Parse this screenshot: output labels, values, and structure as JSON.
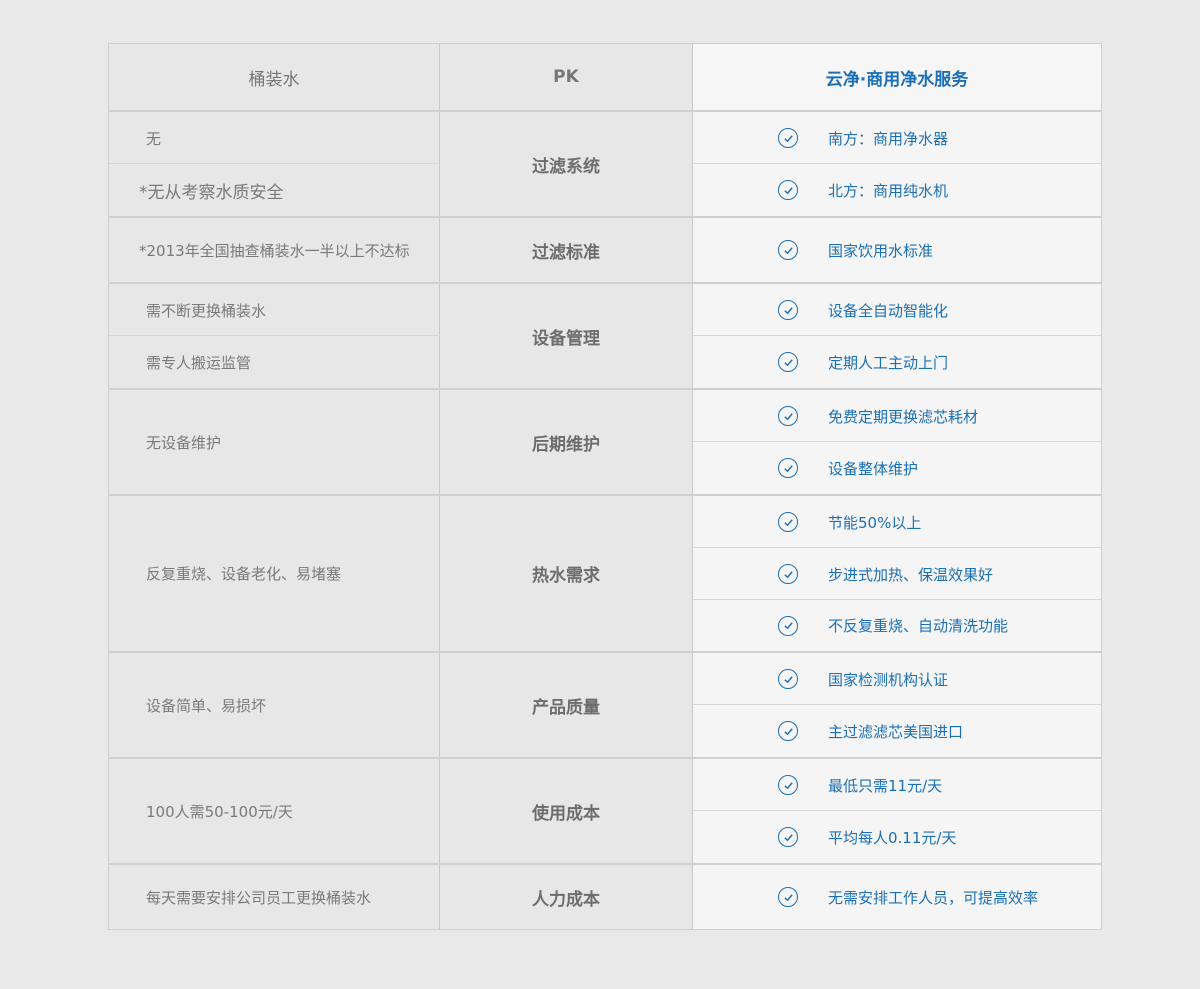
{
  "header": {
    "col_bottled": "桶装水",
    "col_pk": "PK",
    "col_service": "云净·商用净水服务"
  },
  "groups": [
    {
      "category": "过滤系统",
      "bottled": [
        "无",
        "*无从考察水质安全"
      ],
      "service": [
        "南方：商用净水器",
        "北方：商用纯水机"
      ]
    },
    {
      "category": "过滤标准",
      "bottled": [
        "*2013年全国抽查桶装水一半以上不达标"
      ],
      "service": [
        "国家饮用水标准"
      ]
    },
    {
      "category": "设备管理",
      "bottled": [
        "需不断更换桶装水",
        "需专人搬运监管"
      ],
      "service": [
        "设备全自动智能化",
        "定期人工主动上门"
      ]
    },
    {
      "category": "后期维护",
      "bottled": [
        "无设备维护"
      ],
      "service": [
        "免费定期更换滤芯耗材",
        "设备整体维护"
      ]
    },
    {
      "category": "热水需求",
      "bottled": [
        "反复重烧、设备老化、易堵塞"
      ],
      "service": [
        "节能50%以上",
        "步进式加热、保温效果好",
        "不反复重烧、自动清洗功能"
      ]
    },
    {
      "category": "产品质量",
      "bottled": [
        "设备简单、易损坏"
      ],
      "service": [
        "国家检测机构认证",
        "主过滤滤芯美国进口"
      ]
    },
    {
      "category": "使用成本",
      "bottled": [
        "100人需50-100元/天"
      ],
      "service": [
        "最低只需11元/天",
        "平均每人0.11元/天"
      ]
    },
    {
      "category": "人力成本",
      "bottled": [
        "每天需要安排公司员工更换桶装水"
      ],
      "service": [
        "无需安排工作人员，可提高效率"
      ]
    }
  ],
  "colors": {
    "accent": "#1b6fb5",
    "muted_text": "#7a7a7a",
    "background": "#e9e9e9"
  },
  "icons": {
    "check": "check-circle-icon"
  }
}
